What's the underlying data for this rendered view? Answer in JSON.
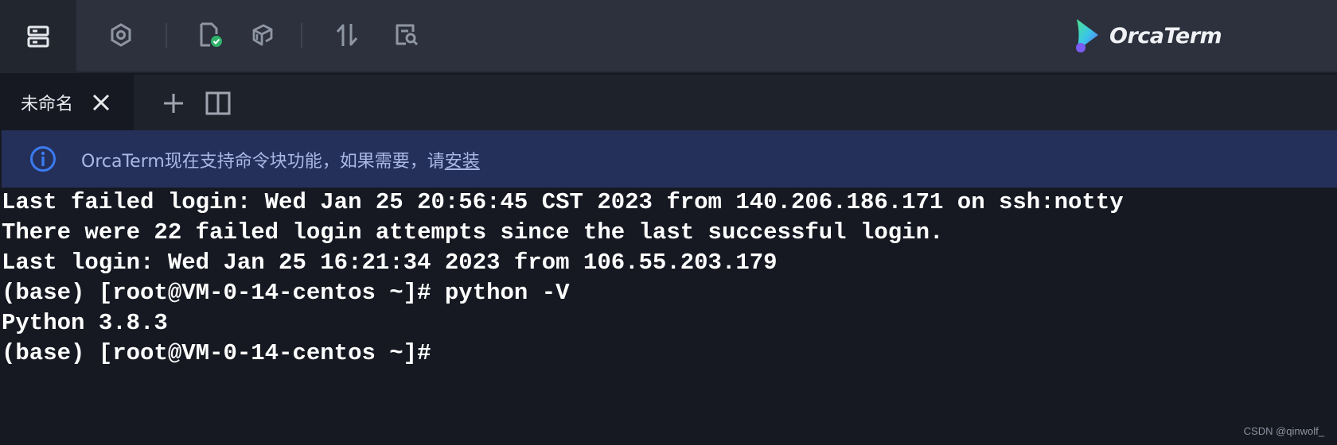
{
  "toolbar": {
    "icons": [
      "server-list-icon",
      "settings-gear-icon",
      "file-check-icon",
      "snippet-stack-icon",
      "transfer-arrows-icon",
      "search-document-icon"
    ],
    "brand": "OrcaTerm",
    "colors": {
      "background": "#2c313d",
      "icon": "#8f96a3",
      "check_badge": "#2fb36b"
    }
  },
  "tabs": [
    {
      "label": "未命名",
      "active": true
    }
  ],
  "notice": {
    "text": "OrcaTerm现在支持命令块功能，如果需要，请",
    "link": "安装",
    "color": "#25305a"
  },
  "terminal": {
    "lines": [
      "Last failed login: Wed Jan 25 20:56:45 CST 2023 from 140.206.186.171 on ssh:notty",
      "There were 22 failed login attempts since the last successful login.",
      "Last login: Wed Jan 25 16:21:34 2023 from 106.55.203.179",
      "(base) [root@VM-0-14-centos ~]# python -V",
      "Python 3.8.3",
      "(base) [root@VM-0-14-centos ~]#"
    ]
  },
  "watermark": "CSDN @qinwolf_"
}
